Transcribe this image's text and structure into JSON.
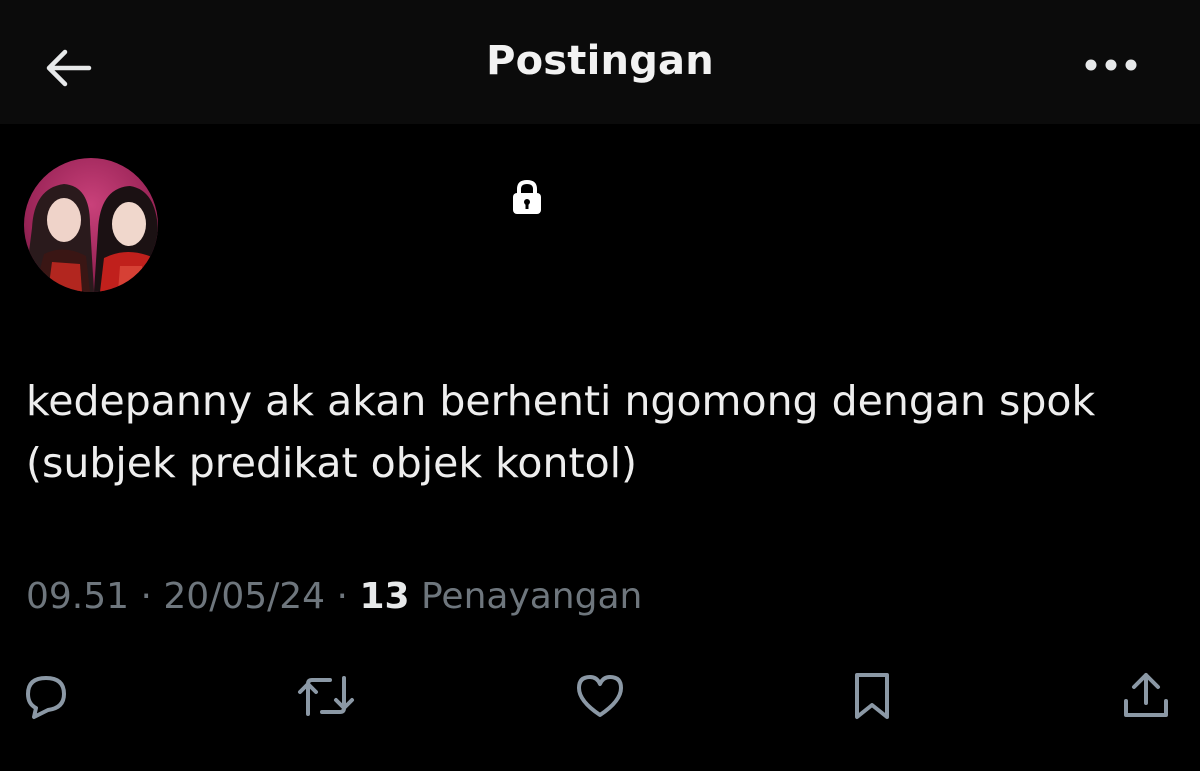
{
  "header": {
    "title": "Postingan",
    "back_icon": "arrow-left-icon",
    "more_icon": "more-horizontal-icon"
  },
  "author": {
    "avatar_icon": "profile-photo",
    "protected_icon": "lock-icon"
  },
  "tweet": {
    "text": "kedepanny ak akan berhenti ngomong dengan spok (subjek predikat objek kontol)",
    "time": "09.51",
    "separator1": " · ",
    "date": "20/05/24",
    "separator2": " · ",
    "views_count": "13",
    "views_label": " Penayangan"
  },
  "actions": {
    "reply_icon": "reply-icon",
    "repost_icon": "repost-icon",
    "like_icon": "heart-icon",
    "bookmark_icon": "bookmark-icon",
    "share_icon": "share-icon"
  },
  "colors": {
    "background": "#000000",
    "header_bg": "#0b0b0b",
    "text_primary": "#e7e9ea",
    "text_secondary": "#6e767d",
    "icon": "#8b98a5"
  }
}
